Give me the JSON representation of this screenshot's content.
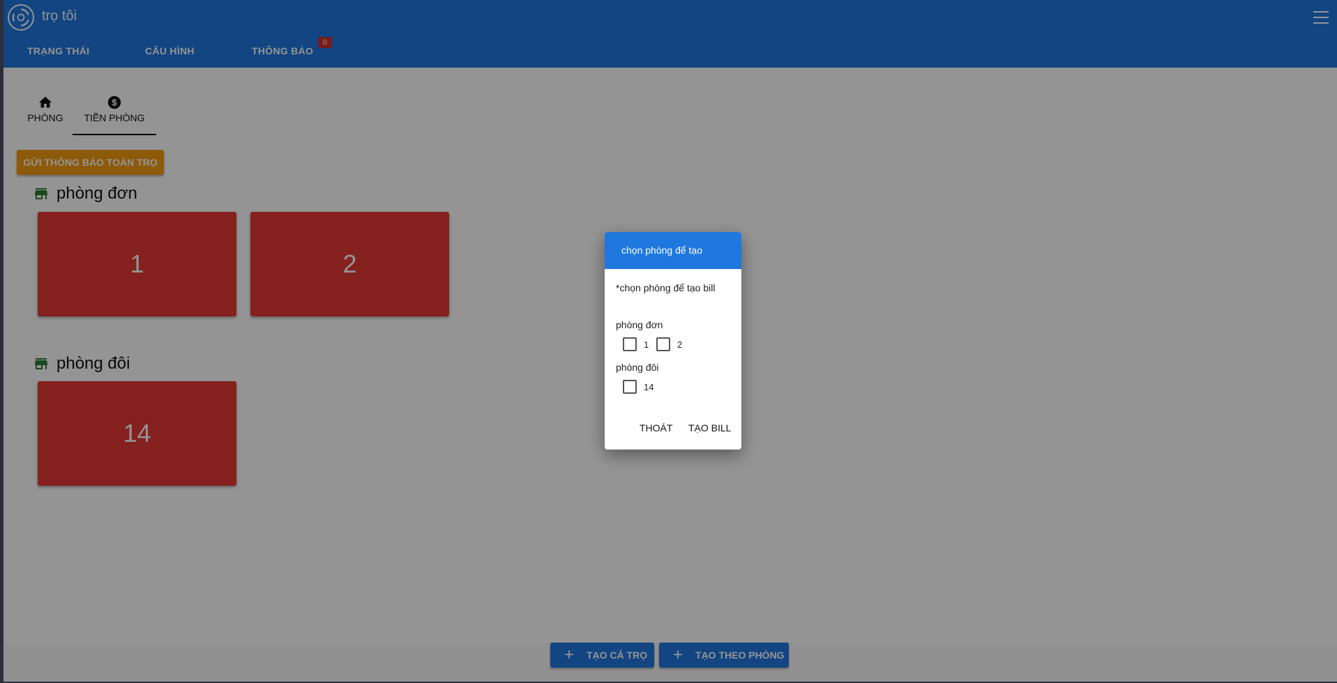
{
  "app": {
    "title": "trọ tôi"
  },
  "nav": {
    "items": [
      {
        "label": "TRẠNG THÁI"
      },
      {
        "label": "CẤU HÌNH"
      },
      {
        "label": "THÔNG BÁO"
      }
    ],
    "notification_count": "0"
  },
  "tabs": [
    {
      "label": "PHÒNG",
      "icon": "home-icon"
    },
    {
      "label": "TIỀN PHÒNG",
      "icon": "dollar-icon"
    }
  ],
  "broadcast_button": "GỬI THÔNG BÁO TOÀN TRỌ",
  "groups": [
    {
      "title": "phòng đơn",
      "rooms": [
        "1",
        "2"
      ]
    },
    {
      "title": "phòng đôi",
      "rooms": [
        "14"
      ]
    }
  ],
  "bottom_buttons": {
    "create_all": "TẠO CẢ TRỌ",
    "create_by_room": "TẠO THEO PHÒNG"
  },
  "dialog": {
    "title": "chọn phòng để tạo",
    "note": "*chọn phòng để tạo bill",
    "groups": [
      {
        "title": "phòng đơn",
        "rooms": [
          "1",
          "2"
        ]
      },
      {
        "title": "phòng đôi",
        "rooms": [
          "14"
        ]
      }
    ],
    "cancel": "THOÁT",
    "confirm": "TẠO BILL"
  },
  "colors": {
    "primary": "#1f78de",
    "room_card": "#e53935",
    "accent_button": "#f39c12",
    "badge": "#d32f2f"
  }
}
